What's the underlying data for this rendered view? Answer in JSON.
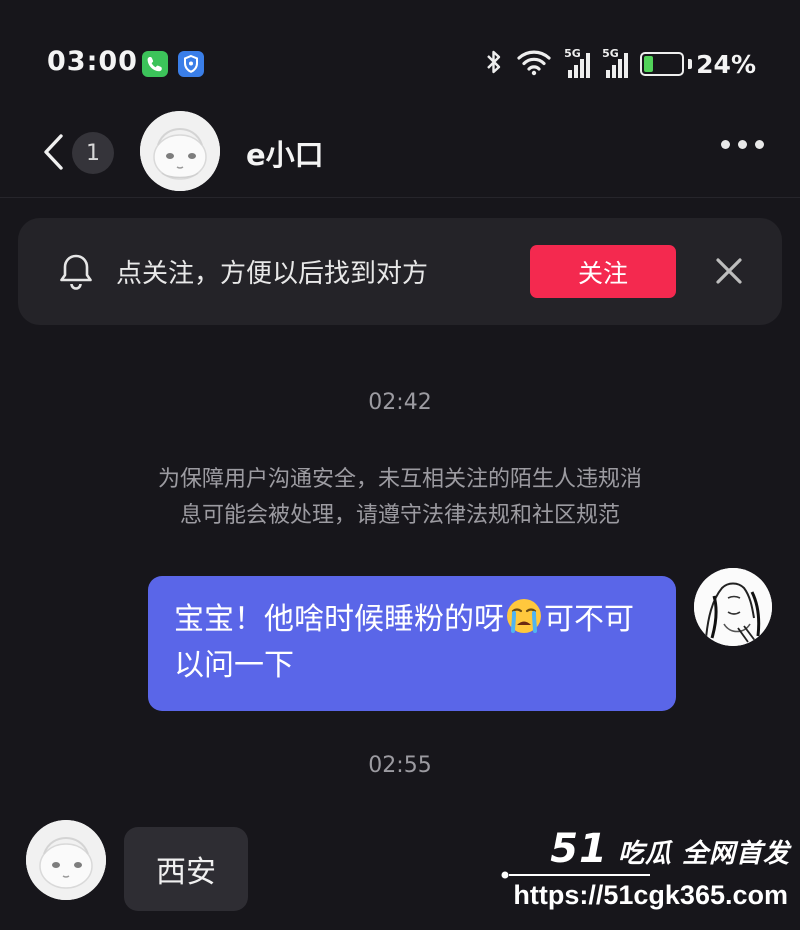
{
  "status_bar": {
    "time": "03:00",
    "notification_icons": [
      "phone-icon",
      "shield-icon"
    ],
    "bluetooth": "bluetooth-icon",
    "wifi": "wifi-icon",
    "signal_1_label": "5G",
    "signal_2_label": "5G",
    "battery_percent_text": "24%",
    "battery_level": 0.24,
    "battery_color": "#52d35a"
  },
  "header": {
    "unread_count": "1",
    "contact_name": "e小口",
    "back_icon": "chevron-left-icon",
    "more_icon": "more-horizontal-icon"
  },
  "follow_banner": {
    "text": "点关注，方便以后找到对方",
    "button_label": "关注",
    "button_color": "#f4294f",
    "bell_icon": "bell-icon",
    "close_icon": "close-icon"
  },
  "messages": {
    "time_1": "02:42",
    "system_notice_line_1": "为保障用户沟通安全，未互相关注的陌生人违规消",
    "system_notice_line_2": "息可能会被处理，请遵守法律法规和社区规范",
    "outgoing_text_before_emoji": "宝宝！他啥时候睡粉的呀",
    "outgoing_emoji": "loudly-crying-face-emoji",
    "outgoing_text_after_emoji": "可不可以问一下",
    "outgoing_bubble_color": "#5a66e8",
    "time_2": "02:55",
    "incoming_text": "西安"
  },
  "watermark": {
    "brand_number": "51",
    "brand_text": "吃瓜 全网首发",
    "url": "https://51cgk365.com"
  }
}
